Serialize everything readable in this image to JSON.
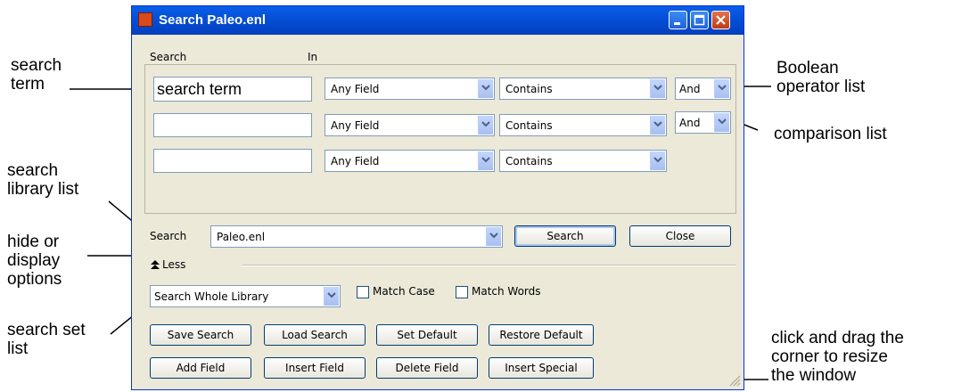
{
  "window": {
    "title": "Search Paleo.enl",
    "search_header": "Search",
    "in_header": "In"
  },
  "rows": [
    {
      "term": "search term",
      "field": "Any Field",
      "comparison": "Contains",
      "boolean": "And"
    },
    {
      "term": "",
      "field": "Any Field",
      "comparison": "Contains",
      "boolean": "And"
    },
    {
      "term": "",
      "field": "Any Field",
      "comparison": "Contains"
    }
  ],
  "library": {
    "label": "Search",
    "value": "Paleo.enl",
    "search_button": "Search",
    "close_button": "Close"
  },
  "options_toggle": {
    "label": "Less"
  },
  "search_set": {
    "value": "Search Whole Library",
    "match_case": "Match Case",
    "match_words": "Match Words"
  },
  "buttons": {
    "save_search": "Save Search",
    "load_search": "Load Search",
    "set_default": "Set Default",
    "restore_default": "Restore Default",
    "add_field": "Add Field",
    "insert_field": "Insert Field",
    "delete_field": "Delete Field",
    "insert_special": "Insert Special"
  },
  "callouts": {
    "search_term": "search\nterm",
    "search_library_list": "search\nlibrary list",
    "hide_display_options": "hide or\ndisplay\noptions",
    "search_set_list": "search set\nlist",
    "boolean_operator_list": "Boolean\noperator list",
    "comparison_list": "comparison list",
    "resize": "click and drag the\ncorner to resize\nthe window"
  },
  "colors": {
    "titlebar": "#0550d8",
    "window_bg": "#ece9d8",
    "close_button": "#c13a12"
  }
}
